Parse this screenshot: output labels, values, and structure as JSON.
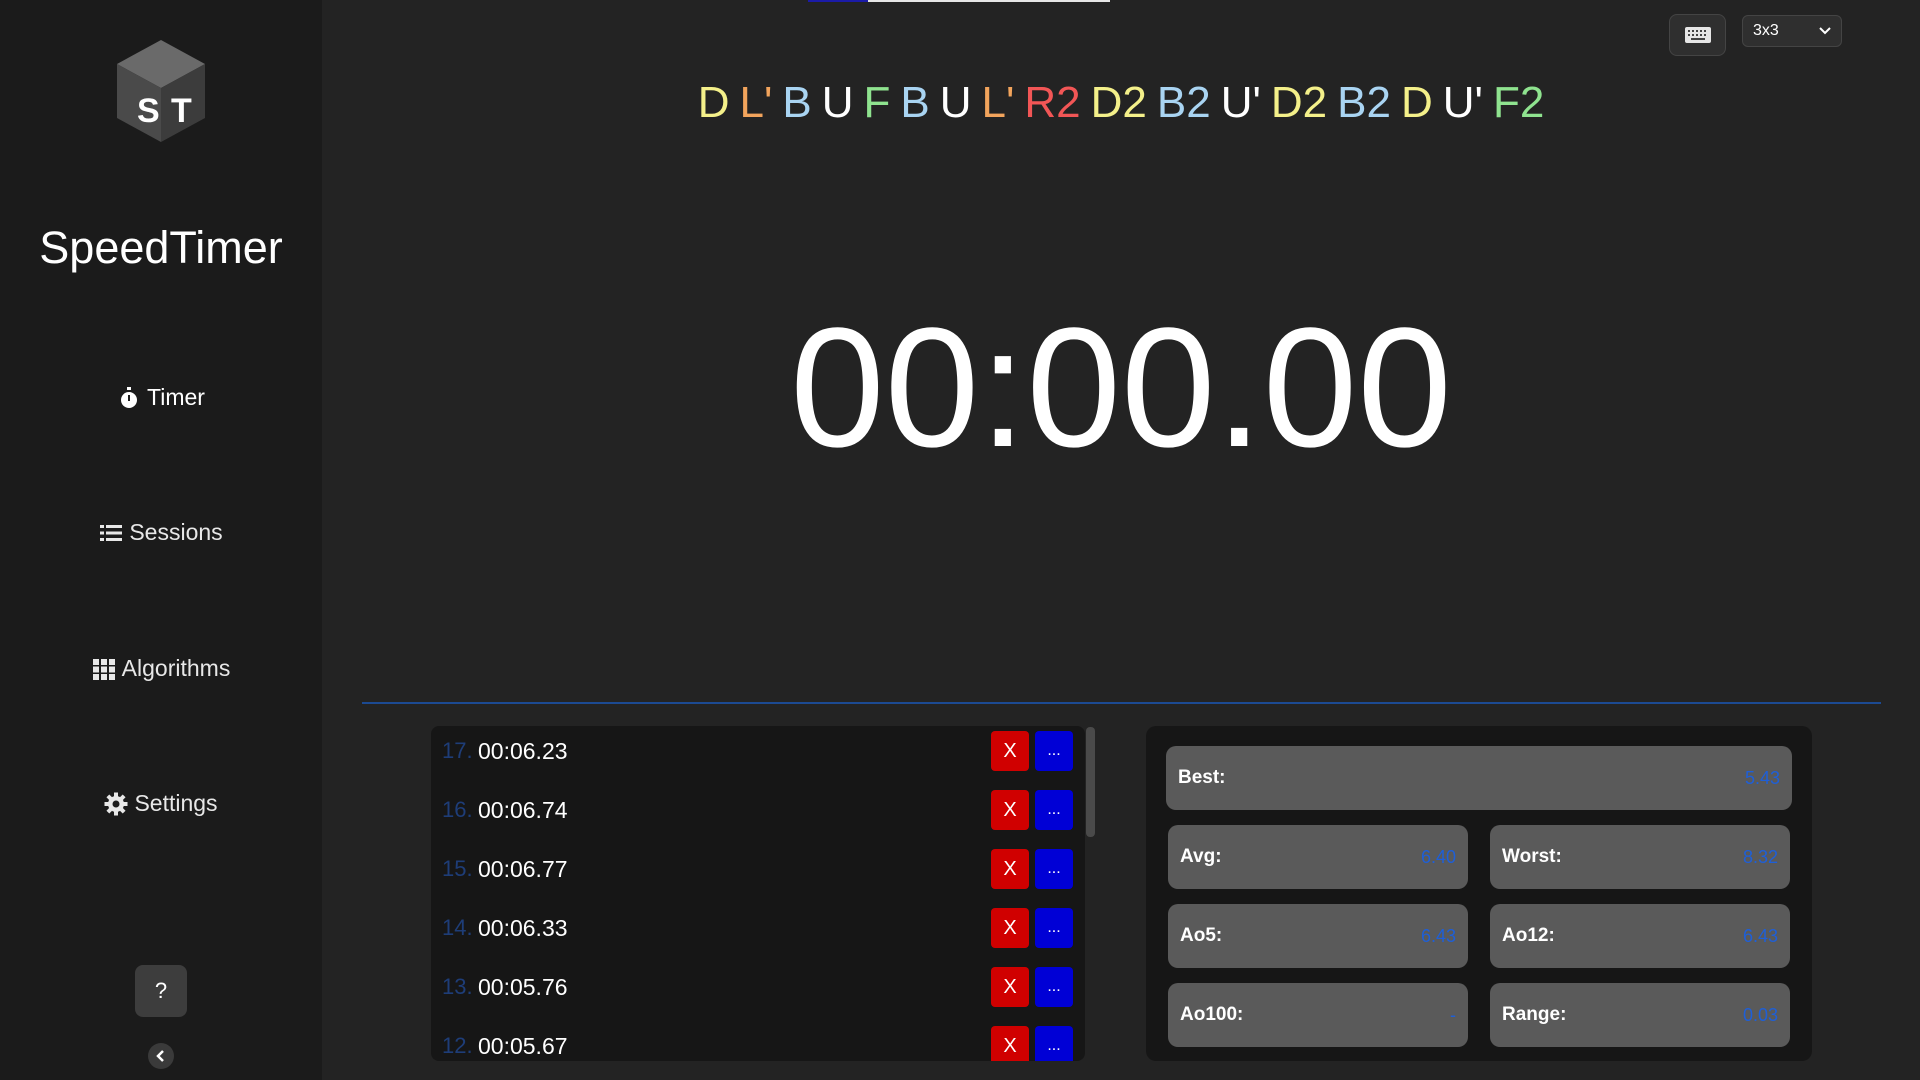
{
  "sidebar": {
    "logo_letters": [
      "S",
      "T"
    ],
    "title": "SpeedTimer",
    "nav": [
      {
        "label": "Timer",
        "icon": "stopwatch-icon",
        "active": true
      },
      {
        "label": "Sessions",
        "icon": "list-icon",
        "active": false
      },
      {
        "label": "Algorithms",
        "icon": "grid-icon",
        "active": false
      },
      {
        "label": "Settings",
        "icon": "gear-icon",
        "active": false
      }
    ],
    "help_label": "?"
  },
  "toolbar": {
    "puzzle_selected": "3x3"
  },
  "scramble": [
    {
      "move": "D",
      "color": "#f4f08a"
    },
    {
      "move": "L'",
      "color": "#f2a45c"
    },
    {
      "move": "B",
      "color": "#a9d4f2"
    },
    {
      "move": "U",
      "color": "#ffffff"
    },
    {
      "move": "F",
      "color": "#8fe38f"
    },
    {
      "move": "B",
      "color": "#a9d4f2"
    },
    {
      "move": "U",
      "color": "#ffffff"
    },
    {
      "move": "L'",
      "color": "#f2a45c"
    },
    {
      "move": "R2",
      "color": "#f25656"
    },
    {
      "move": "D2",
      "color": "#f4f08a"
    },
    {
      "move": "B2",
      "color": "#a9d4f2"
    },
    {
      "move": "U'",
      "color": "#ffffff"
    },
    {
      "move": "D2",
      "color": "#f4f08a"
    },
    {
      "move": "B2",
      "color": "#a9d4f2"
    },
    {
      "move": "D",
      "color": "#f4f08a"
    },
    {
      "move": "U'",
      "color": "#ffffff"
    },
    {
      "move": "F2",
      "color": "#8fe38f"
    }
  ],
  "timer": {
    "display": "00:00.00"
  },
  "solves": [
    {
      "index": "17.",
      "time": "00:06.23"
    },
    {
      "index": "16.",
      "time": "00:06.74"
    },
    {
      "index": "15.",
      "time": "00:06.77"
    },
    {
      "index": "14.",
      "time": "00:06.33"
    },
    {
      "index": "13.",
      "time": "00:05.76"
    },
    {
      "index": "12.",
      "time": "00:05.67"
    }
  ],
  "solve_actions": {
    "delete_label": "X",
    "edit_label": "..."
  },
  "stats": {
    "best": {
      "label": "Best:",
      "value": "5.43"
    },
    "avg": {
      "label": "Avg:",
      "value": "6.40"
    },
    "worst": {
      "label": "Worst:",
      "value": "8.32"
    },
    "ao5": {
      "label": "Ao5:",
      "value": "6.43"
    },
    "ao12": {
      "label": "Ao12:",
      "value": "6.43"
    },
    "ao100": {
      "label": "Ao100:",
      "value": "-"
    },
    "range": {
      "label": "Range:",
      "value": "0.03"
    }
  },
  "colors": {
    "accent_blue": "#1e5fd8",
    "delete_red": "#d00000",
    "edit_blue": "#0000d6"
  }
}
